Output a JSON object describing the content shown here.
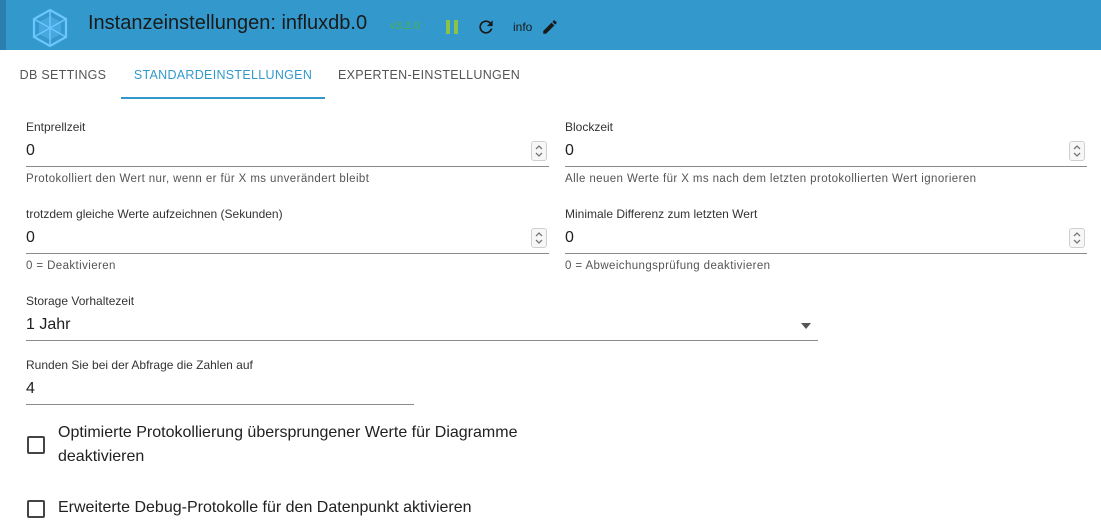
{
  "header": {
    "title": "Instanzeinstellungen: influxdb.0",
    "version": "v3.2.0",
    "info_label": "info",
    "accent_color": "#3399cc"
  },
  "tabs": [
    {
      "label": "DB SETTINGS",
      "active": false
    },
    {
      "label": "STANDARDEINSTELLUNGEN",
      "active": true
    },
    {
      "label": "EXPERTEN-EINSTELLUNGEN",
      "active": false
    }
  ],
  "fields": {
    "entprellzeit": {
      "label": "Entprellzeit",
      "value": "0",
      "helper": "Protokolliert den Wert nur, wenn er für X ms unverändert bleibt"
    },
    "blockzeit": {
      "label": "Blockzeit",
      "value": "0",
      "helper": "Alle neuen Werte für X ms nach dem letzten protokollierten Wert ignorieren"
    },
    "gleiche_werte": {
      "label": "trotzdem gleiche Werte aufzeichnen (Sekunden)",
      "value": "0",
      "helper": "0 = Deaktivieren"
    },
    "min_diff": {
      "label": "Minimale Differenz zum letzten Wert",
      "value": "0",
      "helper": "0 = Abweichungsprüfung deaktivieren"
    },
    "storage": {
      "label": "Storage Vorhaltezeit",
      "value": "1 Jahr"
    },
    "runden": {
      "label": "Runden Sie bei der Abfrage die Zahlen auf",
      "value": "4"
    }
  },
  "checkboxes": [
    {
      "label": "Optimierte Protokollierung übersprungener Werte für Diagramme deaktivieren",
      "checked": false
    },
    {
      "label": "Erweiterte Debug-Protokolle für den Datenpunkt aktivieren",
      "checked": false
    }
  ]
}
